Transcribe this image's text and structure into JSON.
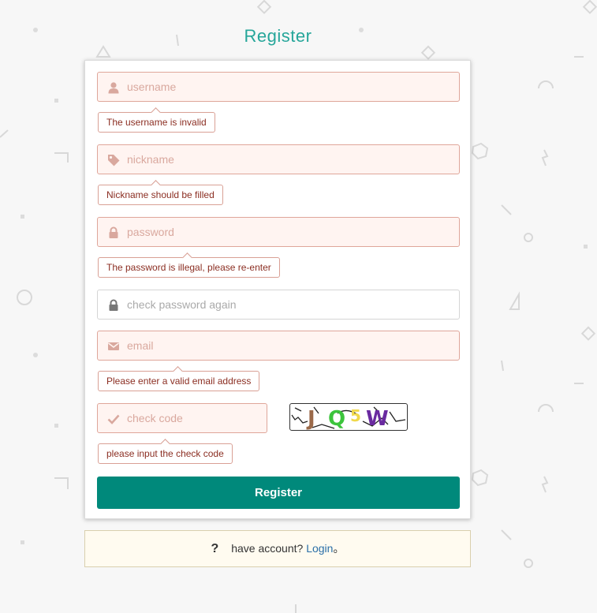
{
  "page": {
    "title": "Register"
  },
  "form": {
    "username": {
      "placeholder": "username",
      "error": "The username is invalid"
    },
    "nickname": {
      "placeholder": "nickname",
      "error": "Nickname should be filled"
    },
    "password": {
      "placeholder": "password",
      "error": "The password is illegal, please re-enter"
    },
    "confirm_password": {
      "placeholder": "check password again"
    },
    "email": {
      "placeholder": "email",
      "error": "Please enter a valid email address"
    },
    "check_code": {
      "placeholder": "check code",
      "error": "please input the check code"
    },
    "captcha": {
      "text": "JQ5W",
      "colors": [
        "#9b6a4a",
        "#3cc43c",
        "#f0d84a",
        "#6a2aa0"
      ]
    },
    "submit_label": "Register"
  },
  "footer": {
    "question_mark": "?",
    "text": "have account?",
    "login_link": "Login",
    "end_punct": "。"
  },
  "colors": {
    "accent": "#00897b",
    "title": "#26a69a",
    "error_border": "#dfa69a",
    "error_bg": "#fff4f1",
    "error_text": "#8b2e22"
  },
  "icons": [
    "user-icon",
    "tag-icon",
    "lock-icon",
    "lock-icon",
    "envelope-icon",
    "check-icon"
  ]
}
